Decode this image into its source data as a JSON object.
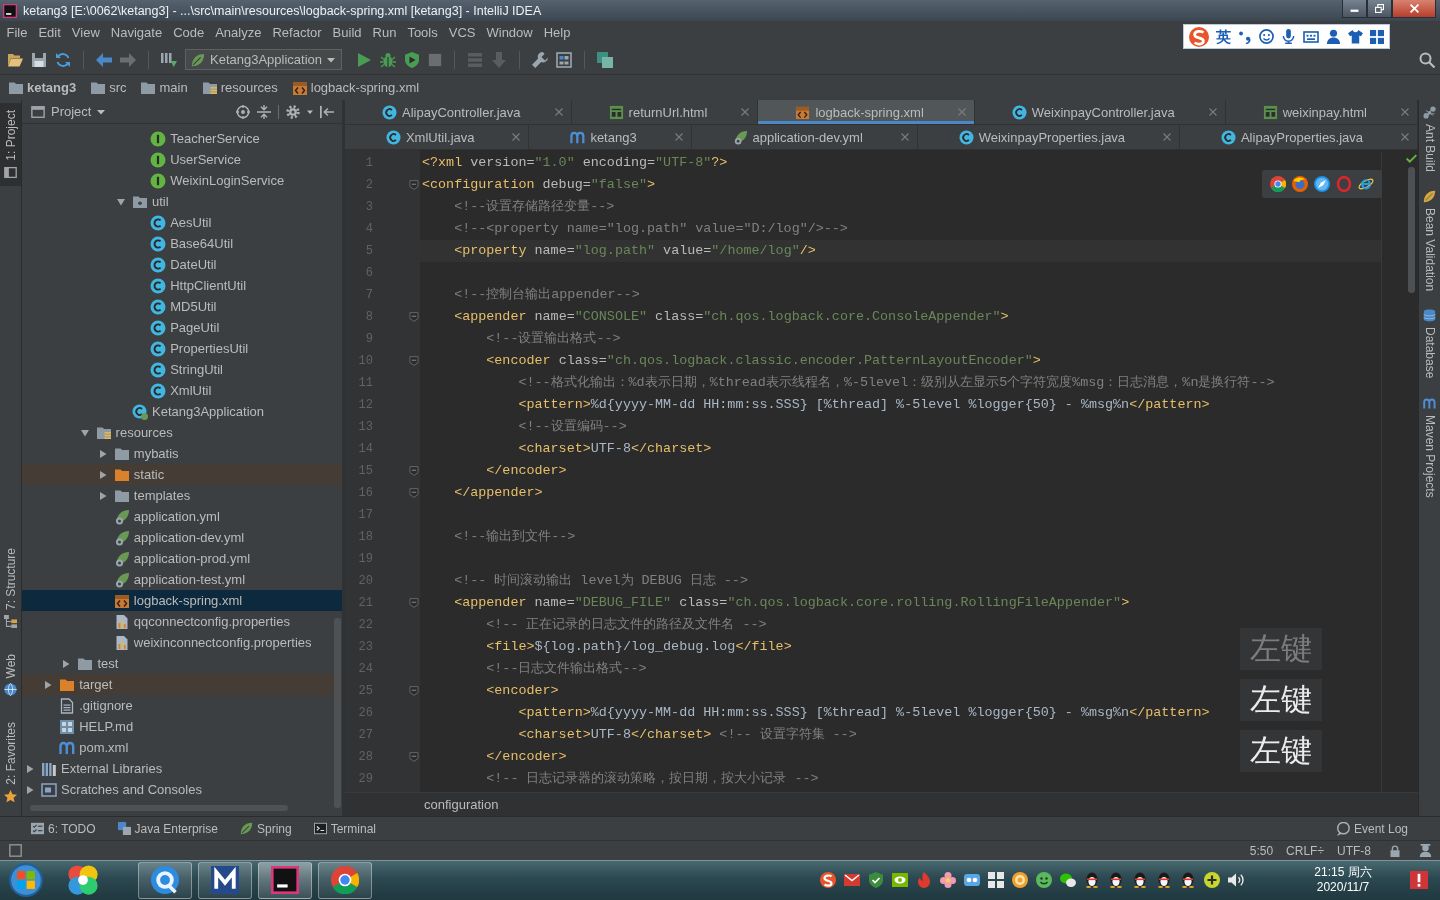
{
  "window": {
    "title": "ketang3 [E:\\0062\\ketang3] - ...\\src\\main\\resources\\logback-spring.xml [ketang3] - IntelliJ IDEA"
  },
  "menu": [
    "File",
    "Edit",
    "View",
    "Navigate",
    "Code",
    "Analyze",
    "Refactor",
    "Build",
    "Run",
    "Tools",
    "VCS",
    "Window",
    "Help"
  ],
  "ime_bar": {
    "mode": "英"
  },
  "toolbar": {
    "run_config": "Ketang3Application"
  },
  "breadcrumbs": [
    {
      "label": "ketang3",
      "kind": "project"
    },
    {
      "label": "src",
      "kind": "folder"
    },
    {
      "label": "main",
      "kind": "folder"
    },
    {
      "label": "resources",
      "kind": "resource-folder"
    },
    {
      "label": "logback-spring.xml",
      "kind": "xml"
    }
  ],
  "left_strip": {
    "top": [
      {
        "label": "1: Project",
        "kind": "project",
        "selected": true
      }
    ],
    "bottom": [
      {
        "label": "7: Structure",
        "kind": "structure",
        "selected": false
      },
      {
        "label": "Web",
        "kind": "web",
        "selected": false
      },
      {
        "label": "2: Favorites",
        "kind": "favorites",
        "selected": false
      }
    ]
  },
  "project": {
    "title": "Project",
    "tree": [
      {
        "children": [
          {
            "children": [
              {
                "children": [
                  {
                    "children": [
                      {
                        "children": [
                          {
                            "children": [
                              {
                                "label": "TeacherService",
                                "kind": "interface",
                                "selected": false
                              },
                              {
                                "label": "UserService",
                                "kind": "interface",
                                "selected": false
                              },
                              {
                                "label": "WeixinLoginService",
                                "kind": "interface",
                                "selected": false
                              }
                            ]
                          },
                          {
                            "label": "util",
                            "kind": "package",
                            "expanded": true,
                            "selected": false,
                            "children": [
                              {
                                "label": "AesUtil",
                                "kind": "class",
                                "selected": false
                              },
                              {
                                "label": "Base64Util",
                                "kind": "class",
                                "selected": false
                              },
                              {
                                "label": "DateUtil",
                                "kind": "class",
                                "selected": false
                              },
                              {
                                "label": "HttpClientUtil",
                                "kind": "class",
                                "selected": false
                              },
                              {
                                "label": "MD5Util",
                                "kind": "class",
                                "selected": false
                              },
                              {
                                "label": "PageUtil",
                                "kind": "class",
                                "selected": false
                              },
                              {
                                "label": "PropertiesUtil",
                                "kind": "class",
                                "selected": false
                              },
                              {
                                "label": "StringUtil",
                                "kind": "class",
                                "selected": false
                              },
                              {
                                "label": "XmlUtil",
                                "kind": "class",
                                "selected": false
                              }
                            ]
                          },
                          {
                            "label": "Ketang3Application",
                            "kind": "app",
                            "selected": false
                          }
                        ]
                      }
                    ]
                  },
                  {
                    "label": "resources",
                    "kind": "resource-folder",
                    "expanded": true,
                    "selected": false,
                    "children": [
                      {
                        "label": "mybatis",
                        "kind": "folder",
                        "expanded": false,
                        "selected": false
                      },
                      {
                        "label": "static",
                        "kind": "excluded-folder",
                        "expanded": false,
                        "selected": false
                      },
                      {
                        "label": "templates",
                        "kind": "folder",
                        "expanded": false,
                        "selected": false
                      },
                      {
                        "label": "application.yml",
                        "kind": "yml",
                        "selected": false
                      },
                      {
                        "label": "application-dev.yml",
                        "kind": "yml",
                        "selected": false
                      },
                      {
                        "label": "application-prod.yml",
                        "kind": "yml",
                        "selected": false
                      },
                      {
                        "label": "application-test.yml",
                        "kind": "yml",
                        "selected": false
                      },
                      {
                        "label": "logback-spring.xml",
                        "kind": "xml",
                        "selected": true
                      },
                      {
                        "label": "qqconnectconfig.properties",
                        "kind": "properties",
                        "selected": false
                      },
                      {
                        "label": "weixinconnectconfig.properties",
                        "kind": "properties",
                        "selected": false
                      }
                    ]
                  }
                ]
              },
              {
                "label": "test",
                "kind": "folder",
                "expanded": false,
                "selected": false
              }
            ]
          },
          {
            "label": "target",
            "kind": "excluded-folder",
            "expanded": false,
            "selected": false
          },
          {
            "label": ".gitignore",
            "kind": "text",
            "selected": false
          },
          {
            "label": "HELP.md",
            "kind": "markdown",
            "selected": false
          },
          {
            "label": "pom.xml",
            "kind": "maven",
            "selected": false
          }
        ]
      },
      {
        "label": "External Libraries",
        "kind": "libraries",
        "expanded": false,
        "selected": false
      },
      {
        "label": "Scratches and Consoles",
        "kind": "scratches",
        "expanded": false,
        "selected": false
      }
    ]
  },
  "editor": {
    "tab_rows": [
      {
        "tabs": [
          {
            "label": "AlipayController.java",
            "kind": "class",
            "selected": false
          },
          {
            "label": "returnUrl.html",
            "kind": "html",
            "selected": false
          },
          {
            "label": "logback-spring.xml",
            "kind": "xml",
            "selected": true
          },
          {
            "label": "WeixinpayController.java",
            "kind": "class",
            "selected": false
          },
          {
            "label": "weixinpay.html",
            "kind": "html",
            "selected": false
          }
        ]
      },
      {
        "tabs": [
          {
            "label": "XmlUtil.java",
            "kind": "class",
            "selected": false
          },
          {
            "label": "ketang3",
            "kind": "maven",
            "selected": false
          },
          {
            "label": "application-dev.yml",
            "kind": "yml",
            "selected": false
          },
          {
            "label": "WeixinpayProperties.java",
            "kind": "class",
            "selected": false
          },
          {
            "label": "AlipayProperties.java",
            "kind": "class",
            "selected": false
          }
        ]
      }
    ],
    "lines": [
      {
        "n": "1",
        "fold": false,
        "current": false,
        "tokens": [
          {
            "kind": "tag",
            "text": "<?xml"
          },
          {
            "kind": "attr",
            "text": " version="
          },
          {
            "kind": "value",
            "text": "\"1.0\""
          },
          {
            "kind": "attr",
            "text": " encoding="
          },
          {
            "kind": "value",
            "text": "\"UTF-8\""
          },
          {
            "kind": "tag",
            "text": "?>"
          }
        ]
      },
      {
        "n": "2",
        "fold": true,
        "current": false,
        "tokens": [
          {
            "kind": "tag",
            "text": "<configuration"
          },
          {
            "kind": "attr",
            "text": " debug="
          },
          {
            "kind": "value",
            "text": "\"false\""
          },
          {
            "kind": "tag",
            "text": ">"
          }
        ]
      },
      {
        "n": "3",
        "fold": false,
        "current": false,
        "tokens": [
          {
            "kind": "comment",
            "text": "    <!--设置存储路径变量-->"
          }
        ]
      },
      {
        "n": "4",
        "fold": false,
        "current": false,
        "tokens": [
          {
            "kind": "comment",
            "text": "    <!--<property name=\"log.path\" value=\"D:/log\"/>-->"
          }
        ]
      },
      {
        "n": "5",
        "fold": false,
        "current": true,
        "tokens": [
          {
            "kind": "tag",
            "text": "    <property"
          },
          {
            "kind": "attr",
            "text": " name="
          },
          {
            "kind": "value",
            "text": "\"log.path\""
          },
          {
            "kind": "attr",
            "text": " value="
          },
          {
            "kind": "value",
            "text": "\"/home/log\""
          },
          {
            "kind": "tag",
            "text": "/>"
          }
        ]
      },
      {
        "n": "6",
        "fold": false,
        "current": false
      },
      {
        "n": "7",
        "fold": false,
        "current": false,
        "tokens": [
          {
            "kind": "comment",
            "text": "    <!--控制台输出appender-->"
          }
        ]
      },
      {
        "n": "8",
        "fold": true,
        "current": false,
        "tokens": [
          {
            "kind": "tag",
            "text": "    <appender"
          },
          {
            "kind": "attr",
            "text": " name="
          },
          {
            "kind": "value",
            "text": "\"CONSOLE\""
          },
          {
            "kind": "attr",
            "text": " class="
          },
          {
            "kind": "value",
            "text": "\"ch.qos.logback.core.ConsoleAppender\""
          },
          {
            "kind": "tag",
            "text": ">"
          }
        ]
      },
      {
        "n": "9",
        "fold": false,
        "current": false,
        "tokens": [
          {
            "kind": "comment",
            "text": "        <!--设置输出格式-->"
          }
        ]
      },
      {
        "n": "10",
        "fold": true,
        "current": false,
        "tokens": [
          {
            "kind": "tag",
            "text": "        <encoder"
          },
          {
            "kind": "attr",
            "text": " class="
          },
          {
            "kind": "value",
            "text": "\"ch.qos.logback.classic.encoder.PatternLayoutEncoder\""
          },
          {
            "kind": "tag",
            "text": ">"
          }
        ]
      },
      {
        "n": "11",
        "fold": false,
        "current": false,
        "tokens": [
          {
            "kind": "comment",
            "text": "            <!--格式化输出：%d表示日期，%thread表示线程名，%-5level：级别从左显示5个字符宽度%msg：日志消息，%n是换行符-->"
          }
        ]
      },
      {
        "n": "12",
        "fold": false,
        "current": false,
        "tokens": [
          {
            "kind": "tag",
            "text": "            <pattern>"
          },
          {
            "kind": "text",
            "text": "%d{yyyy-MM-dd HH:mm:ss.SSS} [%thread] %-5level %logger{50} - %msg%n"
          },
          {
            "kind": "tag",
            "text": "</pattern>"
          }
        ]
      },
      {
        "n": "13",
        "fold": false,
        "current": false,
        "tokens": [
          {
            "kind": "comment",
            "text": "            <!--设置编码-->"
          }
        ]
      },
      {
        "n": "14",
        "fold": false,
        "current": false,
        "tokens": [
          {
            "kind": "tag",
            "text": "            <charset>"
          },
          {
            "kind": "text",
            "text": "UTF-8"
          },
          {
            "kind": "tag",
            "text": "</charset>"
          }
        ]
      },
      {
        "n": "15",
        "fold": true,
        "current": false,
        "tokens": [
          {
            "kind": "tag",
            "text": "        </encoder>"
          }
        ]
      },
      {
        "n": "16",
        "fold": true,
        "current": false,
        "tokens": [
          {
            "kind": "tag",
            "text": "    </appender>"
          }
        ]
      },
      {
        "n": "17",
        "fold": false,
        "current": false
      },
      {
        "n": "18",
        "fold": false,
        "current": false,
        "tokens": [
          {
            "kind": "comment",
            "text": "    <!--输出到文件-->"
          }
        ]
      },
      {
        "n": "19",
        "fold": false,
        "current": false
      },
      {
        "n": "20",
        "fold": false,
        "current": false,
        "tokens": [
          {
            "kind": "comment",
            "text": "    <!-- 时间滚动输出 level为 DEBUG 日志 -->"
          }
        ]
      },
      {
        "n": "21",
        "fold": true,
        "current": false,
        "tokens": [
          {
            "kind": "tag",
            "text": "    <appender"
          },
          {
            "kind": "attr",
            "text": " name="
          },
          {
            "kind": "value",
            "text": "\"DEBUG_FILE\""
          },
          {
            "kind": "attr",
            "text": " class="
          },
          {
            "kind": "value",
            "text": "\"ch.qos.logback.core.rolling.RollingFileAppender\""
          },
          {
            "kind": "tag",
            "text": ">"
          }
        ]
      },
      {
        "n": "22",
        "fold": false,
        "current": false,
        "tokens": [
          {
            "kind": "comment",
            "text": "        <!-- 正在记录的日志文件的路径及文件名 -->"
          }
        ]
      },
      {
        "n": "23",
        "fold": false,
        "current": false,
        "tokens": [
          {
            "kind": "tag",
            "text": "        <file>"
          },
          {
            "kind": "text",
            "text": "${log.path}/log_debug.log"
          },
          {
            "kind": "tag",
            "text": "</file>"
          }
        ]
      },
      {
        "n": "24",
        "fold": false,
        "current": false,
        "tokens": [
          {
            "kind": "comment",
            "text": "        <!--日志文件输出格式-->"
          }
        ]
      },
      {
        "n": "25",
        "fold": true,
        "current": false,
        "tokens": [
          {
            "kind": "tag",
            "text": "        <encoder>"
          }
        ]
      },
      {
        "n": "26",
        "fold": false,
        "current": false,
        "tokens": [
          {
            "kind": "tag",
            "text": "            <pattern>"
          },
          {
            "kind": "text",
            "text": "%d{yyyy-MM-dd HH:mm:ss.SSS} [%thread] %-5level %logger{50} - %msg%n"
          },
          {
            "kind": "tag",
            "text": "</pattern>"
          }
        ]
      },
      {
        "n": "27",
        "fold": false,
        "current": false,
        "tokens": [
          {
            "kind": "tag",
            "text": "            <charset>"
          },
          {
            "kind": "text",
            "text": "UTF-8"
          },
          {
            "kind": "tag",
            "text": "</charset>"
          },
          {
            "kind": "comment",
            "text": " <!-- 设置字符集 -->"
          }
        ]
      },
      {
        "n": "28",
        "fold": true,
        "current": false,
        "tokens": [
          {
            "kind": "tag",
            "text": "        </encoder>"
          }
        ]
      },
      {
        "n": "29",
        "fold": false,
        "current": false,
        "tokens": [
          {
            "kind": "comment",
            "text": "        <!-- 日志记录器的滚动策略，按日期，按大小记录 -->"
          }
        ]
      }
    ],
    "key_overlay": [
      {
        "text": "左键",
        "dim": true
      },
      {
        "text": "左键",
        "dim": false
      },
      {
        "text": "左键",
        "dim": false
      }
    ],
    "breadcrumb": "configuration"
  },
  "right_strip": [
    {
      "label": "Ant Build",
      "kind": "ant"
    },
    {
      "label": "Bean Validation",
      "kind": "bean"
    },
    {
      "label": "Database",
      "kind": "database"
    },
    {
      "label": "Maven Projects",
      "kind": "maven"
    }
  ],
  "bottom_tools": {
    "items": [
      {
        "label": "6: TODO",
        "kind": "todo"
      },
      {
        "label": "Java Enterprise",
        "kind": "enterprise"
      },
      {
        "label": "Spring",
        "kind": "spring"
      },
      {
        "label": "Terminal",
        "kind": "terminal"
      }
    ],
    "event_log": "Event Log"
  },
  "status_bar": {
    "position": "5:50",
    "line_separator": "CRLF÷",
    "encoding": "UTF-8"
  },
  "taskbar": {
    "time": "21:15 周六",
    "date": "2020/11/7"
  }
}
